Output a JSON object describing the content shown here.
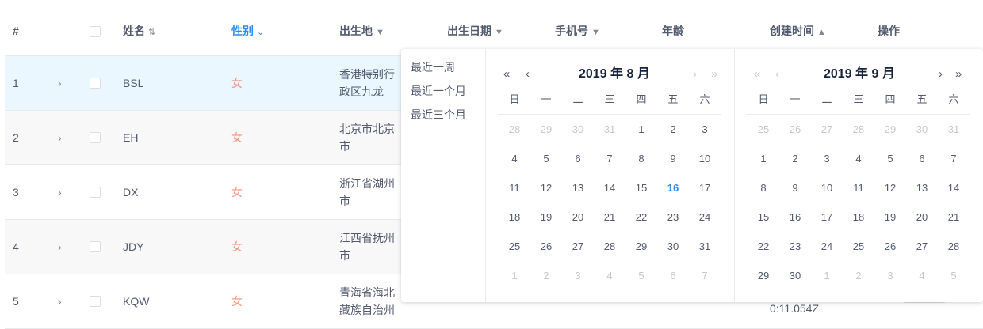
{
  "columns": [
    {
      "label": "#",
      "icon": ""
    },
    {
      "label": "姓名",
      "icon": "⇅"
    },
    {
      "label": "性别",
      "icon": "⌄"
    },
    {
      "label": "出生地",
      "icon": "▼"
    },
    {
      "label": "出生日期",
      "icon": "▼"
    },
    {
      "label": "手机号",
      "icon": "▼"
    },
    {
      "label": "年龄",
      "icon": ""
    },
    {
      "label": "创建时间",
      "icon": "▲"
    },
    {
      "label": "操作",
      "icon": ""
    }
  ],
  "rows": [
    {
      "index": "1",
      "name": "BSL",
      "gender": "女",
      "place": "香港特别行政区九龙",
      "expand": "›"
    },
    {
      "index": "2",
      "name": "EH",
      "gender": "女",
      "place": "北京市北京市",
      "expand": "›"
    },
    {
      "index": "3",
      "name": "DX",
      "gender": "女",
      "place": "浙江省湖州市",
      "expand": "›"
    },
    {
      "index": "4",
      "name": "JDY",
      "gender": "女",
      "place": "江西省抚州市",
      "expand": "›"
    },
    {
      "index": "5",
      "name": "KQW",
      "gender": "女",
      "place": "青海省海北藏族自治州",
      "expand": "›"
    }
  ],
  "row5_created_time_partial": "0:11.054Z",
  "picker": {
    "shortcuts": [
      "最近一周",
      "最近一个月",
      "最近三个月"
    ],
    "weekdays": [
      "日",
      "一",
      "二",
      "三",
      "四",
      "五",
      "六"
    ],
    "nav": {
      "prev_year": "«",
      "prev_month": "‹",
      "next_month": "›",
      "next_year": "»"
    },
    "left": {
      "title": "2019 年 8 月",
      "weeks": [
        [
          {
            "d": "28",
            "o": true
          },
          {
            "d": "29",
            "o": true
          },
          {
            "d": "30",
            "o": true
          },
          {
            "d": "31",
            "o": true
          },
          {
            "d": "1"
          },
          {
            "d": "2"
          },
          {
            "d": "3"
          }
        ],
        [
          {
            "d": "4"
          },
          {
            "d": "5"
          },
          {
            "d": "6"
          },
          {
            "d": "7"
          },
          {
            "d": "8"
          },
          {
            "d": "9"
          },
          {
            "d": "10"
          }
        ],
        [
          {
            "d": "11"
          },
          {
            "d": "12"
          },
          {
            "d": "13"
          },
          {
            "d": "14"
          },
          {
            "d": "15"
          },
          {
            "d": "16",
            "today": true
          },
          {
            "d": "17"
          }
        ],
        [
          {
            "d": "18"
          },
          {
            "d": "19"
          },
          {
            "d": "20"
          },
          {
            "d": "21"
          },
          {
            "d": "22"
          },
          {
            "d": "23"
          },
          {
            "d": "24"
          }
        ],
        [
          {
            "d": "25"
          },
          {
            "d": "26"
          },
          {
            "d": "27"
          },
          {
            "d": "28"
          },
          {
            "d": "29"
          },
          {
            "d": "30"
          },
          {
            "d": "31"
          }
        ],
        [
          {
            "d": "1",
            "o": true
          },
          {
            "d": "2",
            "o": true
          },
          {
            "d": "3",
            "o": true
          },
          {
            "d": "4",
            "o": true
          },
          {
            "d": "5",
            "o": true
          },
          {
            "d": "6",
            "o": true
          },
          {
            "d": "7",
            "o": true
          }
        ]
      ]
    },
    "right": {
      "title": "2019 年 9 月",
      "weeks": [
        [
          {
            "d": "25",
            "o": true
          },
          {
            "d": "26",
            "o": true
          },
          {
            "d": "27",
            "o": true
          },
          {
            "d": "28",
            "o": true
          },
          {
            "d": "29",
            "o": true
          },
          {
            "d": "30",
            "o": true
          },
          {
            "d": "31",
            "o": true
          }
        ],
        [
          {
            "d": "1"
          },
          {
            "d": "2"
          },
          {
            "d": "3"
          },
          {
            "d": "4"
          },
          {
            "d": "5"
          },
          {
            "d": "6"
          },
          {
            "d": "7"
          }
        ],
        [
          {
            "d": "8"
          },
          {
            "d": "9"
          },
          {
            "d": "10"
          },
          {
            "d": "11"
          },
          {
            "d": "12"
          },
          {
            "d": "13"
          },
          {
            "d": "14"
          }
        ],
        [
          {
            "d": "15"
          },
          {
            "d": "16"
          },
          {
            "d": "17"
          },
          {
            "d": "18"
          },
          {
            "d": "19"
          },
          {
            "d": "20"
          },
          {
            "d": "21"
          }
        ],
        [
          {
            "d": "22"
          },
          {
            "d": "23"
          },
          {
            "d": "24"
          },
          {
            "d": "25"
          },
          {
            "d": "26"
          },
          {
            "d": "27"
          },
          {
            "d": "28"
          }
        ],
        [
          {
            "d": "29"
          },
          {
            "d": "30"
          },
          {
            "d": "1",
            "o": true
          },
          {
            "d": "2",
            "o": true
          },
          {
            "d": "3",
            "o": true
          },
          {
            "d": "4",
            "o": true
          },
          {
            "d": "5",
            "o": true
          }
        ]
      ]
    }
  }
}
